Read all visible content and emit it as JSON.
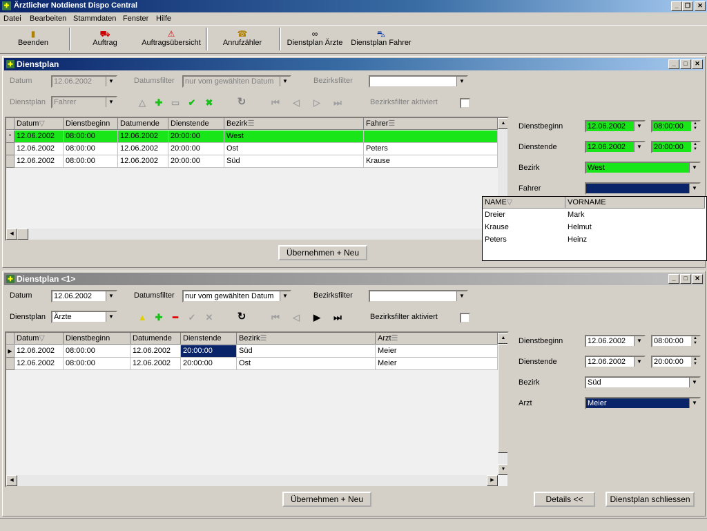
{
  "app": {
    "title": "Ärztlicher Notdienst Dispo Central"
  },
  "menu": [
    "Datei",
    "Bearbeiten",
    "Stammdaten",
    "Fenster",
    "Hilfe"
  ],
  "toolbar": {
    "beenden": "Beenden",
    "auftrag": "Auftrag",
    "auftragsuebersicht": "Auftragsübersicht",
    "anrufzaehler": "Anrufzähler",
    "dienstplan_aerzte": "Dienstplan Ärzte",
    "dienstplan_fahrer": "Dienstplan Fahrer"
  },
  "colors": {
    "highlight_green": "#19e619",
    "selection_blue": "#0a246a"
  },
  "panel1": {
    "title": "Dienstplan",
    "datum_label": "Datum",
    "datum_value": "12.06.2002",
    "datumsfilter_label": "Datumsfilter",
    "datumsfilter_value": "nur vom gewählten Datum",
    "bezirksfilter_label": "Bezirksfilter",
    "bezirksfilter_value": "",
    "dienstplan_label": "Dienstplan",
    "dienstplan_value": "Fahrer",
    "bezirksfilter_aktiviert_label": "Bezirksfilter aktiviert",
    "columns": [
      "Datum",
      "Dienstbeginn",
      "Datumende",
      "Dienstende",
      "Bezirk",
      "Fahrer"
    ],
    "rows": [
      {
        "indicator": "*",
        "cells": [
          "12.06.2002",
          "08:00:00",
          "12.06.2002",
          "20:00:00",
          "West",
          ""
        ]
      },
      {
        "indicator": "",
        "cells": [
          "12.06.2002",
          "08:00:00",
          "12.06.2002",
          "20:00:00",
          "Ost",
          "Peters"
        ]
      },
      {
        "indicator": "",
        "cells": [
          "12.06.2002",
          "08:00:00",
          "12.06.2002",
          "20:00:00",
          "Süd",
          "Krause"
        ]
      }
    ],
    "uebernehmen_label": "Übernehmen + Neu",
    "detail": {
      "dienstbeginn_label": "Dienstbeginn",
      "dienstbeginn_date": "12.06.2002",
      "dienstbeginn_time": "08:00:00",
      "dienstende_label": "Dienstende",
      "dienstende_date": "12.06.2002",
      "dienstende_time": "20:00:00",
      "bezirk_label": "Bezirk",
      "bezirk_value": "West",
      "fahrer_label": "Fahrer",
      "fahrer_value": ""
    },
    "dropdown": {
      "columns": [
        "NAME",
        "VORNAME"
      ],
      "rows": [
        [
          "Dreier",
          "Mark"
        ],
        [
          "Krause",
          "Helmut"
        ],
        [
          "Peters",
          "Heinz"
        ]
      ]
    }
  },
  "panel2": {
    "title": "Dienstplan <1>",
    "datum_label": "Datum",
    "datum_value": "12.06.2002",
    "datumsfilter_label": "Datumsfilter",
    "datumsfilter_value": "nur vom gewählten Datum",
    "bezirksfilter_label": "Bezirksfilter",
    "bezirksfilter_value": "",
    "dienstplan_label": "Dienstplan",
    "dienstplan_value": "Ärzte",
    "bezirksfilter_aktiviert_label": "Bezirksfilter aktiviert",
    "columns": [
      "Datum",
      "Dienstbeginn",
      "Datumende",
      "Dienstende",
      "Bezirk",
      "Arzt"
    ],
    "rows": [
      {
        "indicator": "▶",
        "cells": [
          "12.06.2002",
          "08:00:00",
          "12.06.2002",
          "20:00:00",
          "Süd",
          "Meier"
        ]
      },
      {
        "indicator": "",
        "cells": [
          "12.06.2002",
          "08:00:00",
          "12.06.2002",
          "20:00:00",
          "Ost",
          "Meier"
        ]
      }
    ],
    "uebernehmen_label": "Übernehmen + Neu",
    "details_label": "Details <<",
    "schliessen_label": "Dienstplan schliessen",
    "detail": {
      "dienstbeginn_label": "Dienstbeginn",
      "dienstbeginn_date": "12.06.2002",
      "dienstbeginn_time": "08:00:00",
      "dienstende_label": "Dienstende",
      "dienstende_date": "12.06.2002",
      "dienstende_time": "20:00:00",
      "bezirk_label": "Bezirk",
      "bezirk_value": "Süd",
      "arzt_label": "Arzt",
      "arzt_value": "Meier"
    }
  }
}
